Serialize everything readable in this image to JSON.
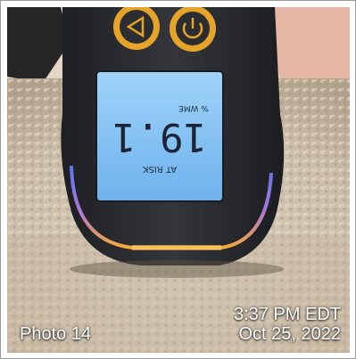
{
  "photo": {
    "label": "Photo 14",
    "time": "3:37 PM EDT",
    "date": "Oct 25, 2022"
  },
  "device": {
    "status_text": "AT RISK",
    "reading": "19.1",
    "unit": "% WME",
    "colors": {
      "display": "#7fc0f0",
      "glow_top": "#5a7cff",
      "glow_bottom": "#ffb13a",
      "button_ring": "#e6a52a",
      "body": "#2b2d31"
    }
  }
}
